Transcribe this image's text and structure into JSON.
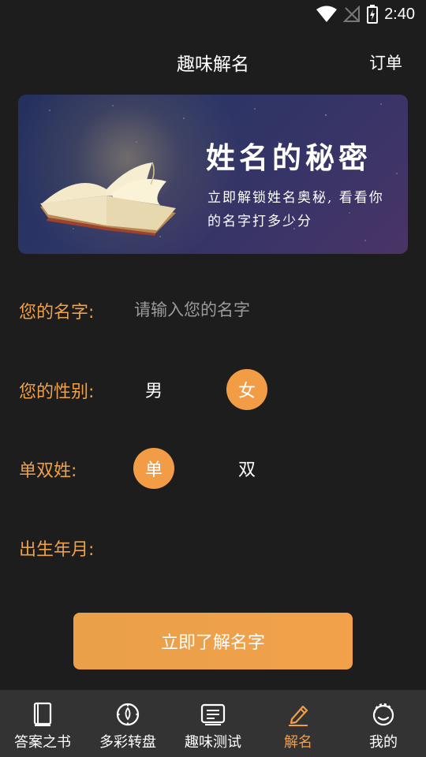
{
  "status_bar": {
    "time": "2:40"
  },
  "header": {
    "title": "趣味解名",
    "orders_label": "订单"
  },
  "banner": {
    "title": "姓名的秘密",
    "subtitle": "立即解锁姓名奥秘, 看看你的名字打多少分"
  },
  "form": {
    "name": {
      "label": "您的名字:",
      "placeholder": "请输入您的名字",
      "value": ""
    },
    "gender": {
      "label": "您的性别:",
      "options": [
        "男",
        "女"
      ],
      "selected": "女"
    },
    "surname": {
      "label": "单双姓:",
      "options": [
        "单",
        "双"
      ],
      "selected": "单"
    },
    "birth": {
      "label": "出生年月:",
      "value": ""
    }
  },
  "submit_label": "立即了解名字",
  "tabs": [
    {
      "label": "答案之书",
      "icon": "book-icon",
      "active": false
    },
    {
      "label": "多彩转盘",
      "icon": "compass-icon",
      "active": false
    },
    {
      "label": "趣味测试",
      "icon": "quiz-icon",
      "active": false
    },
    {
      "label": "解名",
      "icon": "pencil-icon",
      "active": true
    },
    {
      "label": "我的",
      "icon": "profile-icon",
      "active": false
    }
  ],
  "colors": {
    "accent": "#f29d46",
    "background": "#1e1d1d",
    "tabbar": "#333333"
  }
}
